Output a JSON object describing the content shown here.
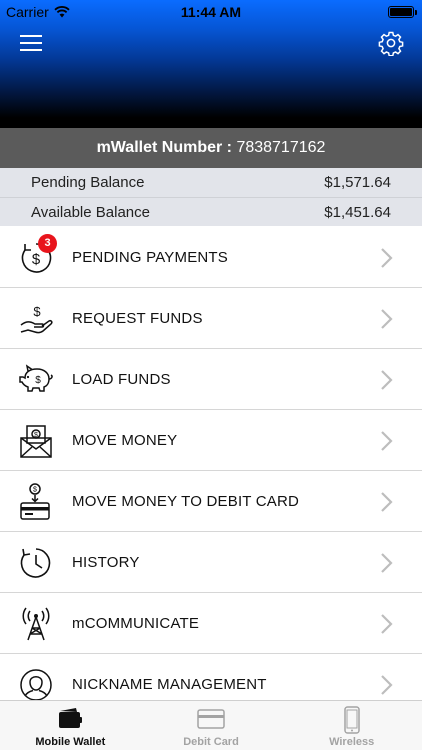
{
  "status_bar": {
    "carrier": "Carrier",
    "time": "11:44 AM"
  },
  "wallet": {
    "label": "mWallet Number :",
    "number": "7838717162"
  },
  "balances": [
    {
      "label": "Pending Balance",
      "amount": "$1,571.64"
    },
    {
      "label": "Available Balance",
      "amount": "$1,451.64"
    }
  ],
  "menu": [
    {
      "label": "PENDING PAYMENTS",
      "icon": "pending-payment-icon",
      "badge": "3"
    },
    {
      "label": "REQUEST FUNDS",
      "icon": "hand-dollar-icon"
    },
    {
      "label": "LOAD FUNDS",
      "icon": "piggy-bank-icon"
    },
    {
      "label": "MOVE MONEY",
      "icon": "money-envelope-icon"
    },
    {
      "label": "MOVE MONEY TO DEBIT CARD",
      "icon": "card-transfer-icon"
    },
    {
      "label": "HISTORY",
      "icon": "clock-history-icon"
    },
    {
      "label": "mCOMMUNICATE",
      "icon": "antenna-tower-icon"
    },
    {
      "label": "NICKNAME MANAGEMENT",
      "icon": "user-profile-icon"
    }
  ],
  "tabs": [
    {
      "label": "Mobile Wallet",
      "icon": "wallet-icon",
      "active": true
    },
    {
      "label": "Debit Card",
      "icon": "debit-card-icon",
      "active": false
    },
    {
      "label": "Wireless",
      "icon": "phone-icon",
      "active": false
    }
  ],
  "colors": {
    "header_top": "#0a6cff",
    "header_bottom": "#000000",
    "wallet_bar": "#5b5b5b",
    "balances_bg": "#e2e4ea",
    "badge": "#e8141c"
  }
}
